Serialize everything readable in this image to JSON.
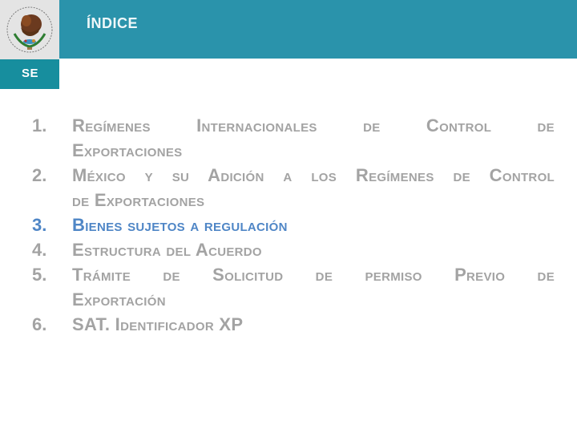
{
  "header": {
    "title": "ÍNDICE",
    "agency_label": "SE",
    "emblem": "mexican-coat-of-arms-icon",
    "emblem_text": "ESTADOS UNIDOS MEXICANOS"
  },
  "colors": {
    "title_band": "#2a93ab",
    "agency_box": "#178e9e",
    "logo_bg": "#e4e4e4",
    "item_default": "#a3a3a3",
    "item_active": "#4f86c6"
  },
  "toc": {
    "items": [
      {
        "number": "1.",
        "line_a": "Regímenes Internacionales de Control de",
        "line_b": "Exportaciones",
        "active": false
      },
      {
        "number": "2.",
        "line_a": "México y su Adición a los Regímenes de Control",
        "line_b": "de Exportaciones",
        "active": false
      },
      {
        "number": "3.",
        "line_a": "Bienes sujetos a regulación",
        "line_b": "",
        "active": true
      },
      {
        "number": "4.",
        "line_a": "Estructura del Acuerdo",
        "line_b": "",
        "active": false
      },
      {
        "number": "5.",
        "line_a": "Trámite de Solicitud de permiso Previo de",
        "line_b": "Exportación",
        "active": false
      },
      {
        "number": "6.",
        "line_a": "SAT. Identificador XP",
        "line_b": "",
        "active": false
      }
    ]
  }
}
